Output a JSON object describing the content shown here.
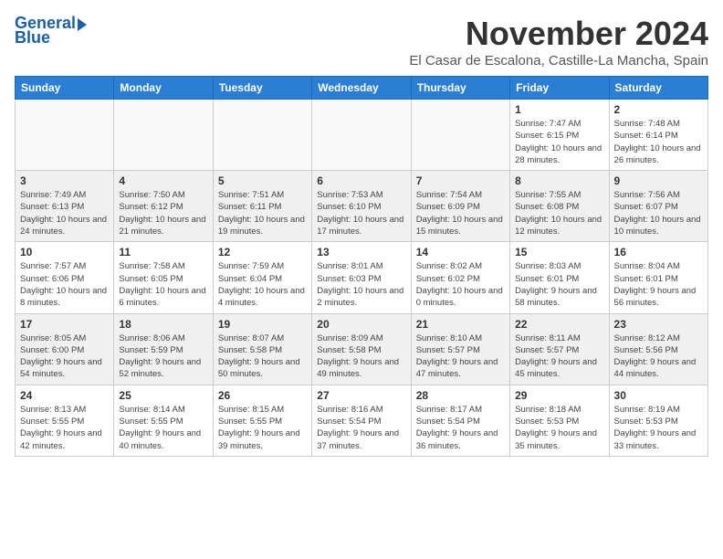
{
  "header": {
    "logo_line1": "General",
    "logo_line2": "Blue",
    "month": "November 2024",
    "location": "El Casar de Escalona, Castille-La Mancha, Spain"
  },
  "weekdays": [
    "Sunday",
    "Monday",
    "Tuesday",
    "Wednesday",
    "Thursday",
    "Friday",
    "Saturday"
  ],
  "weeks": [
    [
      {
        "day": "",
        "info": ""
      },
      {
        "day": "",
        "info": ""
      },
      {
        "day": "",
        "info": ""
      },
      {
        "day": "",
        "info": ""
      },
      {
        "day": "",
        "info": ""
      },
      {
        "day": "1",
        "info": "Sunrise: 7:47 AM\nSunset: 6:15 PM\nDaylight: 10 hours and 28 minutes."
      },
      {
        "day": "2",
        "info": "Sunrise: 7:48 AM\nSunset: 6:14 PM\nDaylight: 10 hours and 26 minutes."
      }
    ],
    [
      {
        "day": "3",
        "info": "Sunrise: 7:49 AM\nSunset: 6:13 PM\nDaylight: 10 hours and 24 minutes."
      },
      {
        "day": "4",
        "info": "Sunrise: 7:50 AM\nSunset: 6:12 PM\nDaylight: 10 hours and 21 minutes."
      },
      {
        "day": "5",
        "info": "Sunrise: 7:51 AM\nSunset: 6:11 PM\nDaylight: 10 hours and 19 minutes."
      },
      {
        "day": "6",
        "info": "Sunrise: 7:53 AM\nSunset: 6:10 PM\nDaylight: 10 hours and 17 minutes."
      },
      {
        "day": "7",
        "info": "Sunrise: 7:54 AM\nSunset: 6:09 PM\nDaylight: 10 hours and 15 minutes."
      },
      {
        "day": "8",
        "info": "Sunrise: 7:55 AM\nSunset: 6:08 PM\nDaylight: 10 hours and 12 minutes."
      },
      {
        "day": "9",
        "info": "Sunrise: 7:56 AM\nSunset: 6:07 PM\nDaylight: 10 hours and 10 minutes."
      }
    ],
    [
      {
        "day": "10",
        "info": "Sunrise: 7:57 AM\nSunset: 6:06 PM\nDaylight: 10 hours and 8 minutes."
      },
      {
        "day": "11",
        "info": "Sunrise: 7:58 AM\nSunset: 6:05 PM\nDaylight: 10 hours and 6 minutes."
      },
      {
        "day": "12",
        "info": "Sunrise: 7:59 AM\nSunset: 6:04 PM\nDaylight: 10 hours and 4 minutes."
      },
      {
        "day": "13",
        "info": "Sunrise: 8:01 AM\nSunset: 6:03 PM\nDaylight: 10 hours and 2 minutes."
      },
      {
        "day": "14",
        "info": "Sunrise: 8:02 AM\nSunset: 6:02 PM\nDaylight: 10 hours and 0 minutes."
      },
      {
        "day": "15",
        "info": "Sunrise: 8:03 AM\nSunset: 6:01 PM\nDaylight: 9 hours and 58 minutes."
      },
      {
        "day": "16",
        "info": "Sunrise: 8:04 AM\nSunset: 6:01 PM\nDaylight: 9 hours and 56 minutes."
      }
    ],
    [
      {
        "day": "17",
        "info": "Sunrise: 8:05 AM\nSunset: 6:00 PM\nDaylight: 9 hours and 54 minutes."
      },
      {
        "day": "18",
        "info": "Sunrise: 8:06 AM\nSunset: 5:59 PM\nDaylight: 9 hours and 52 minutes."
      },
      {
        "day": "19",
        "info": "Sunrise: 8:07 AM\nSunset: 5:58 PM\nDaylight: 9 hours and 50 minutes."
      },
      {
        "day": "20",
        "info": "Sunrise: 8:09 AM\nSunset: 5:58 PM\nDaylight: 9 hours and 49 minutes."
      },
      {
        "day": "21",
        "info": "Sunrise: 8:10 AM\nSunset: 5:57 PM\nDaylight: 9 hours and 47 minutes."
      },
      {
        "day": "22",
        "info": "Sunrise: 8:11 AM\nSunset: 5:57 PM\nDaylight: 9 hours and 45 minutes."
      },
      {
        "day": "23",
        "info": "Sunrise: 8:12 AM\nSunset: 5:56 PM\nDaylight: 9 hours and 44 minutes."
      }
    ],
    [
      {
        "day": "24",
        "info": "Sunrise: 8:13 AM\nSunset: 5:55 PM\nDaylight: 9 hours and 42 minutes."
      },
      {
        "day": "25",
        "info": "Sunrise: 8:14 AM\nSunset: 5:55 PM\nDaylight: 9 hours and 40 minutes."
      },
      {
        "day": "26",
        "info": "Sunrise: 8:15 AM\nSunset: 5:55 PM\nDaylight: 9 hours and 39 minutes."
      },
      {
        "day": "27",
        "info": "Sunrise: 8:16 AM\nSunset: 5:54 PM\nDaylight: 9 hours and 37 minutes."
      },
      {
        "day": "28",
        "info": "Sunrise: 8:17 AM\nSunset: 5:54 PM\nDaylight: 9 hours and 36 minutes."
      },
      {
        "day": "29",
        "info": "Sunrise: 8:18 AM\nSunset: 5:53 PM\nDaylight: 9 hours and 35 minutes."
      },
      {
        "day": "30",
        "info": "Sunrise: 8:19 AM\nSunset: 5:53 PM\nDaylight: 9 hours and 33 minutes."
      }
    ]
  ]
}
